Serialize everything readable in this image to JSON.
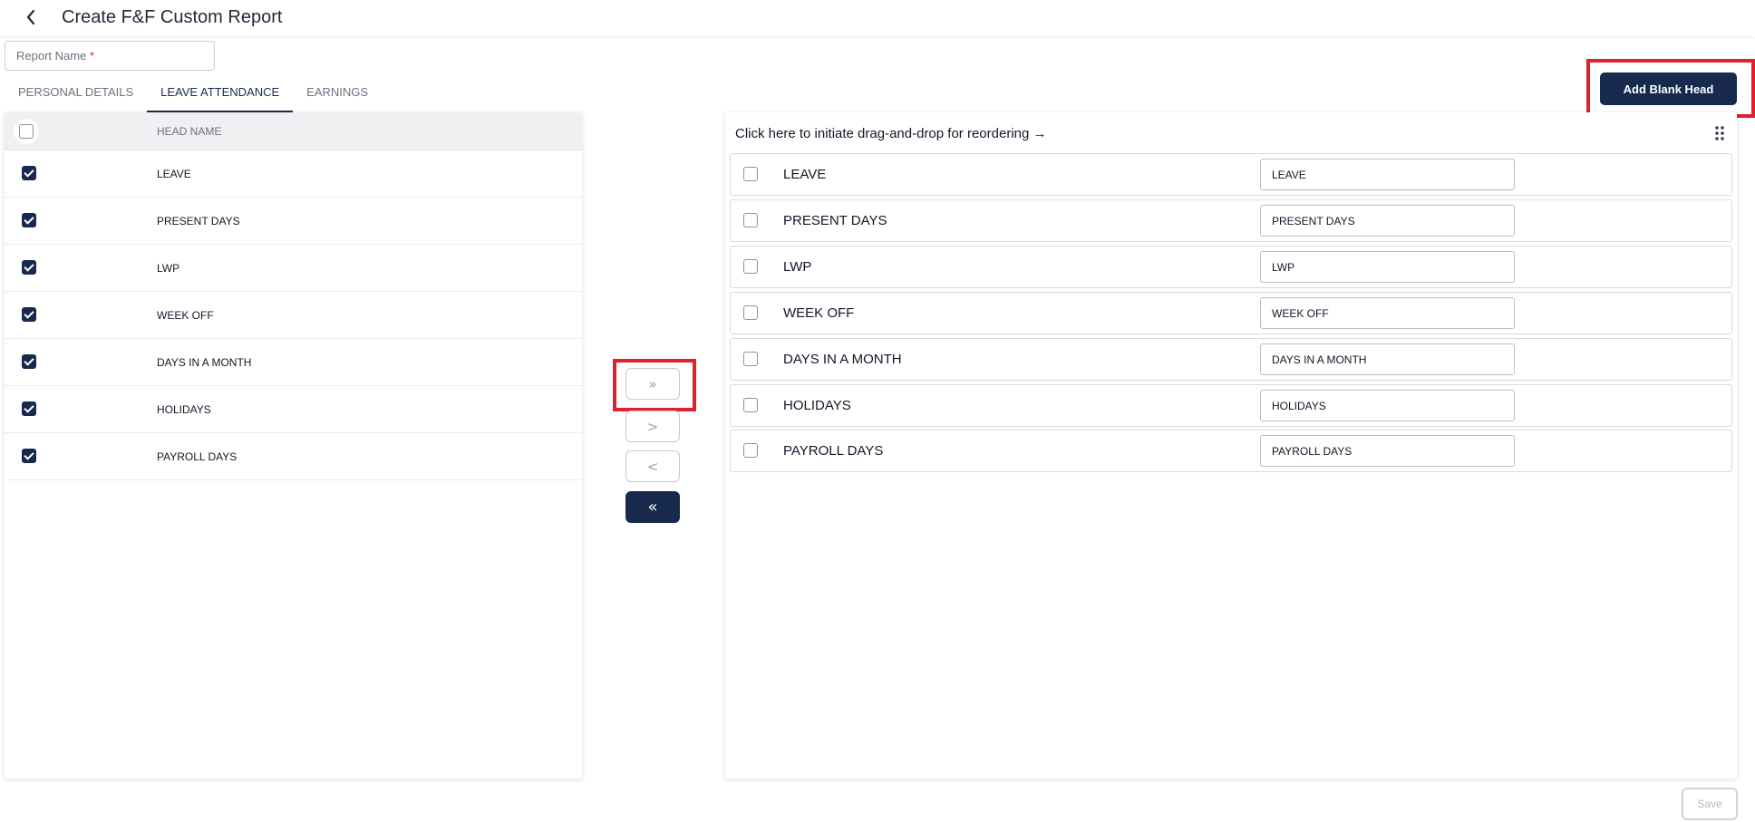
{
  "header": {
    "title": "Create F&F Custom Report"
  },
  "form": {
    "report_name_label": "Report Name",
    "required_mark": "*"
  },
  "tabs": [
    {
      "label": "PERSONAL DETAILS"
    },
    {
      "label": "LEAVE ATTENDANCE",
      "active": true
    },
    {
      "label": "EARNINGS"
    }
  ],
  "actions": {
    "add_blank_head": "Add Blank Head",
    "save": "Save"
  },
  "left_table": {
    "column_header": "HEAD NAME",
    "select_all_checked": false,
    "rows": [
      {
        "name": "LEAVE",
        "checked": true
      },
      {
        "name": "PRESENT DAYS",
        "checked": true
      },
      {
        "name": "LWP",
        "checked": true
      },
      {
        "name": "WEEK OFF",
        "checked": true
      },
      {
        "name": "DAYS IN A MONTH",
        "checked": true
      },
      {
        "name": "HOLIDAYS",
        "checked": true
      },
      {
        "name": "PAYROLL DAYS",
        "checked": true
      }
    ]
  },
  "transfer_buttons": {
    "move_all_right": "»",
    "move_right": ">",
    "move_left": "<",
    "move_all_left": "«"
  },
  "right_panel": {
    "hint": "Click here to initiate drag-and-drop for reordering →",
    "rows": [
      {
        "name": "LEAVE",
        "value": "LEAVE",
        "checked": false
      },
      {
        "name": "PRESENT DAYS",
        "value": "PRESENT DAYS",
        "checked": false
      },
      {
        "name": "LWP",
        "value": "LWP",
        "checked": false
      },
      {
        "name": "WEEK OFF",
        "value": "WEEK OFF",
        "checked": false
      },
      {
        "name": "DAYS IN A MONTH",
        "value": "DAYS IN A MONTH",
        "checked": false
      },
      {
        "name": "HOLIDAYS",
        "value": "HOLIDAYS",
        "checked": false
      },
      {
        "name": "PAYROLL DAYS",
        "value": "PAYROLL DAYS",
        "checked": false
      }
    ]
  },
  "colors": {
    "primary": "#172a4d",
    "highlight": "#e0202e",
    "required": "#d32f2f"
  },
  "icons": {
    "back": "chevron-left-icon",
    "grip": "drag-grip-icon"
  }
}
